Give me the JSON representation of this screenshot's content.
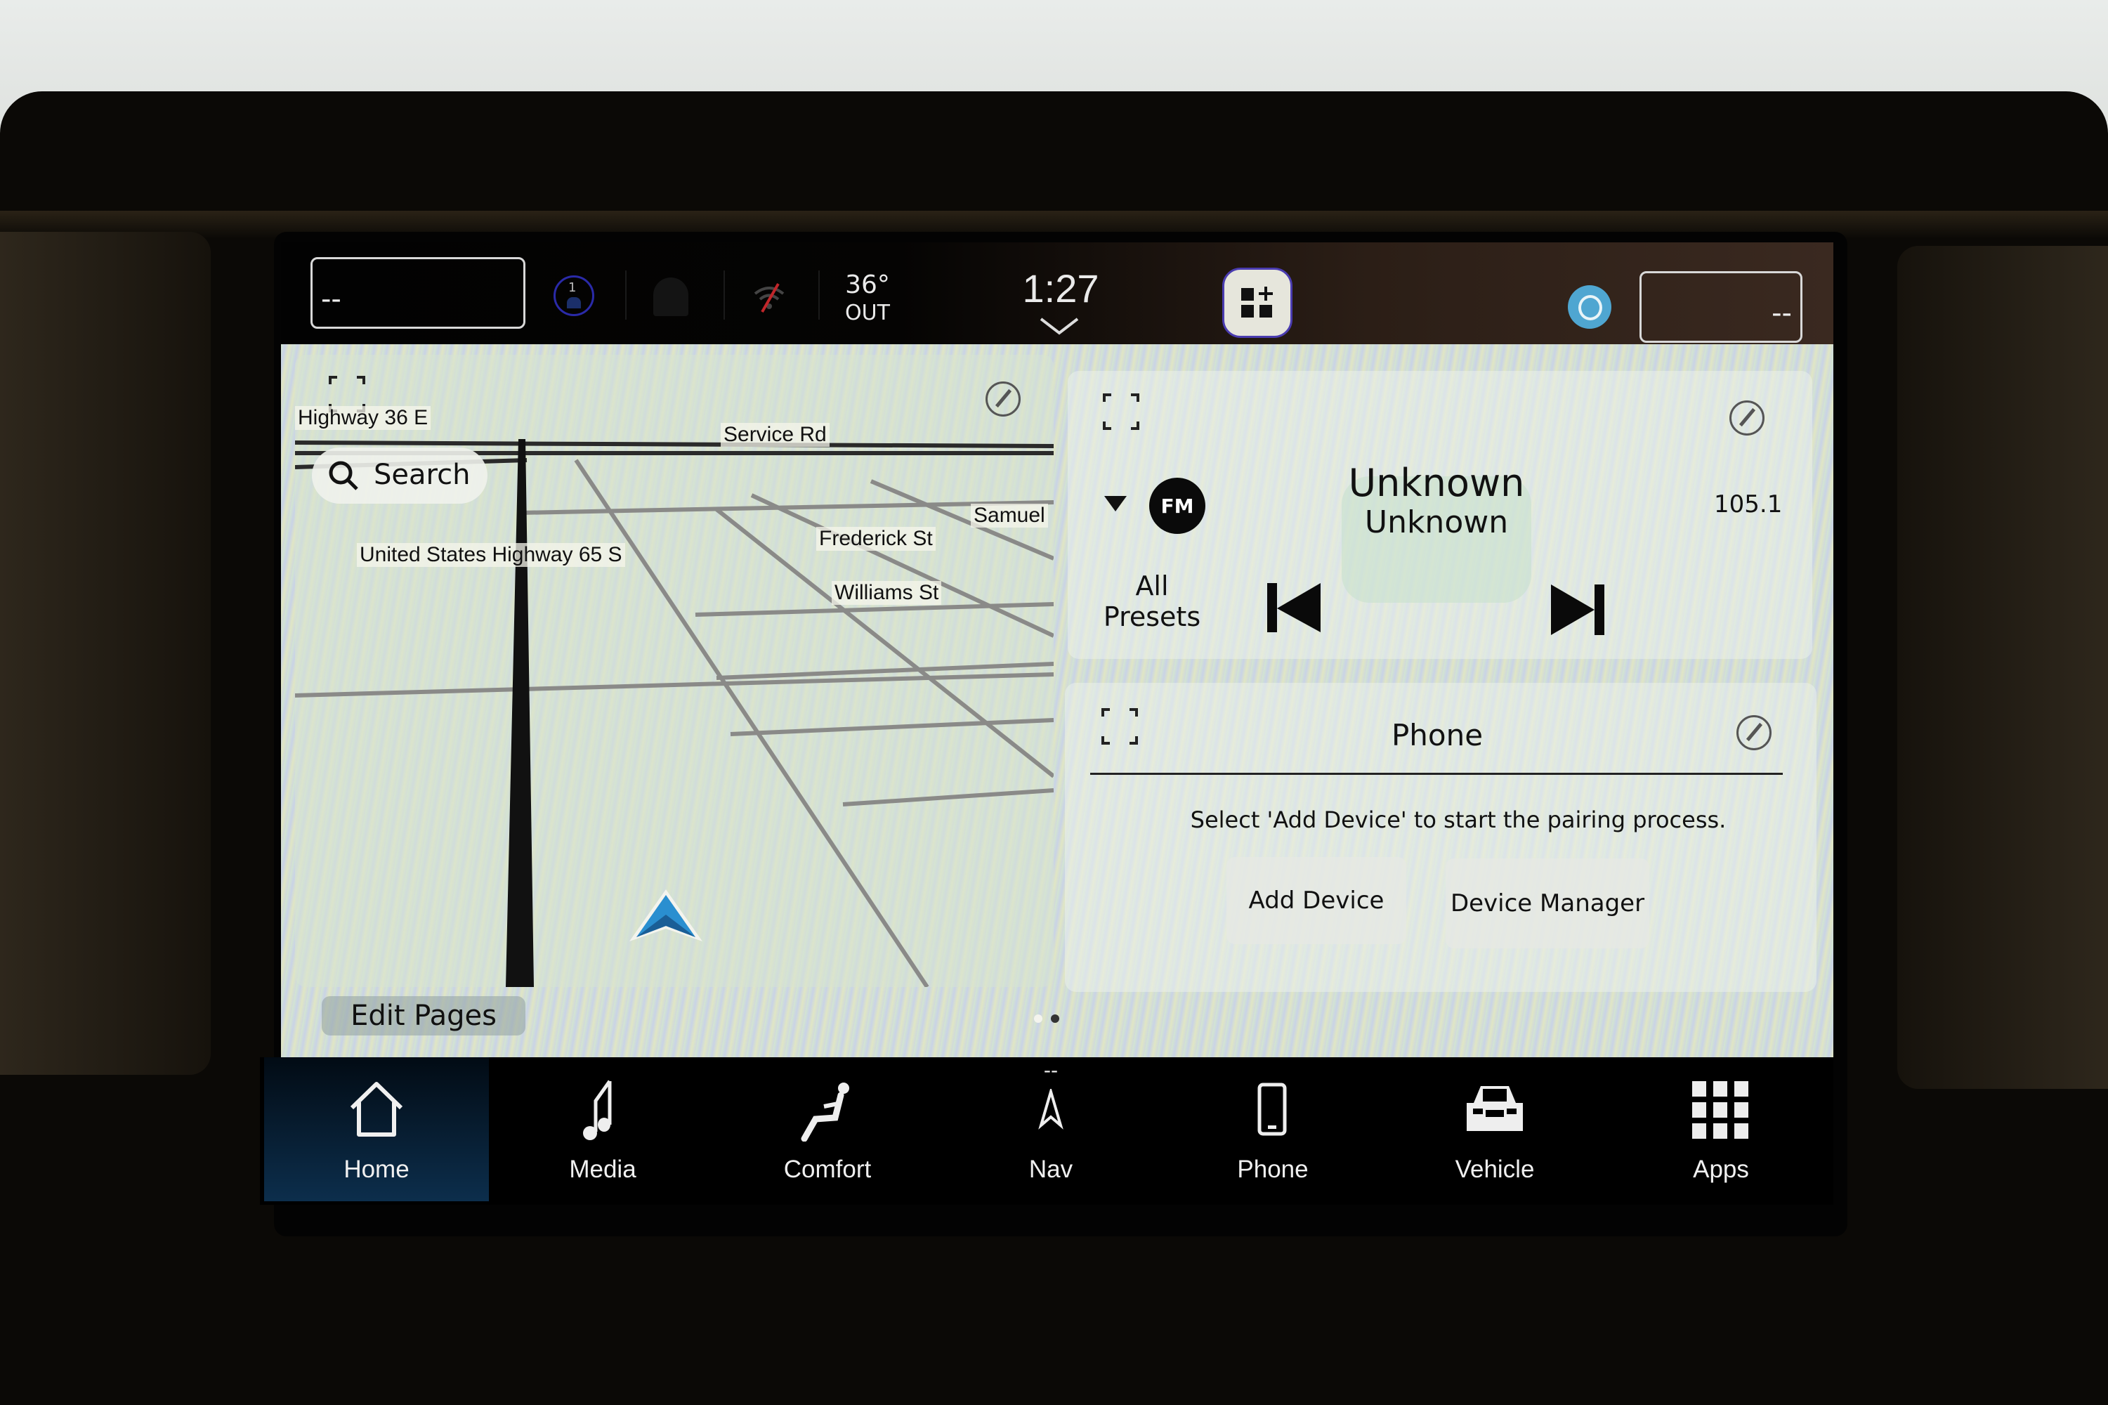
{
  "status_bar": {
    "driver_temp": "--",
    "passenger_temp": "--",
    "profile_number": "1",
    "outside_temp": "36°",
    "outside_label": "OUT",
    "clock": "1:27"
  },
  "map": {
    "search_label": "Search",
    "roads": [
      "Highway 36 E",
      "Service Rd",
      "Samuel",
      "Frederick St",
      "United States Highway 65 S",
      "Williams St"
    ]
  },
  "media_card": {
    "band": "FM",
    "title": "Unknown",
    "subtitle": "Unknown",
    "frequency": "105.1",
    "presets_label_1": "All",
    "presets_label_2": "Presets"
  },
  "phone_card": {
    "title": "Phone",
    "message": "Select 'Add Device' to start the pairing process.",
    "add_device_label": "Add Device",
    "device_manager_label": "Device Manager"
  },
  "edit_pages_label": "Edit Pages",
  "page_indicator": {
    "current": 2,
    "total": 2
  },
  "nav": {
    "items": [
      {
        "label": "Home",
        "icon": "home-icon",
        "active": true
      },
      {
        "label": "Media",
        "icon": "music-note-icon"
      },
      {
        "label": "Comfort",
        "icon": "seat-icon"
      },
      {
        "label": "Nav",
        "icon": "navigation-arrow-icon",
        "top_text": "--"
      },
      {
        "label": "Phone",
        "icon": "phone-icon"
      },
      {
        "label": "Vehicle",
        "icon": "car-icon"
      },
      {
        "label": "Apps",
        "icon": "apps-grid-icon"
      }
    ]
  },
  "colors": {
    "home_active": "#0c2e4c",
    "alexa": "#4fa6d1",
    "profile_ring": "#2a2aa8",
    "wifi_off_slash": "#c0262a",
    "nav_arrow": "#2a8fd0"
  }
}
